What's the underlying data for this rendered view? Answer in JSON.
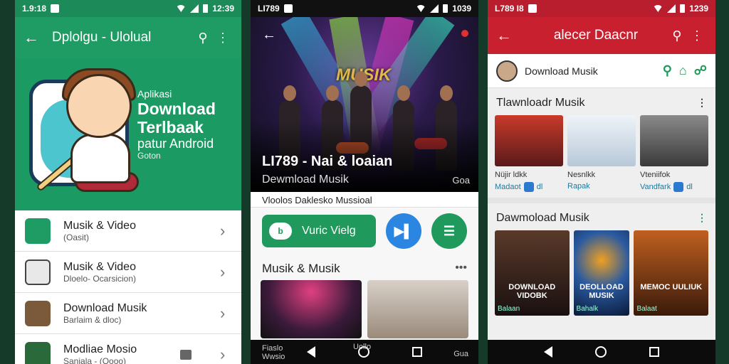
{
  "phone1": {
    "status_time": "1.9:18",
    "status_clock": "12:39",
    "title": "Dplolgu - Ulolual",
    "hero": {
      "line1": "Aplikasi",
      "line2": "Download",
      "line3": "Terlbaak",
      "line4": "patur Android",
      "line5": "Goton"
    },
    "items": [
      {
        "name": "Musik & Video",
        "sub": "(Oasit)",
        "color": "#1e9c64"
      },
      {
        "name": "Musik & Video",
        "sub": "Dloelo- Ocarsicion)",
        "color": "#eeeeee"
      },
      {
        "name": "Download Musik",
        "sub": "Barlaim & dloc)",
        "color": "#7a5a3a"
      },
      {
        "name": "Modliae Mosio",
        "sub": "Saniala - (Oooo)",
        "color": "#2a6a3a"
      }
    ]
  },
  "phone2": {
    "status_time": "LI789",
    "status_clock": "1039",
    "stage_logo": "MUSIK",
    "caption_title": "LI789 - Nai & loaian",
    "caption_sub": "Dewmload Musik",
    "caption_side": "Goa",
    "subline": "Vloolos Daklesko Mussioal",
    "btn_label": "Vuric Vielg",
    "btn_pill": "b",
    "circle1": "▶▌",
    "circle2": "☰",
    "section": "Musik & Musik",
    "nav_left": "Fiaslo Wwsio",
    "nav_mid": "Uollo",
    "nav_right": "Gua"
  },
  "phone3": {
    "status_time": "L789 I8",
    "status_clock": "1239",
    "title": "alecer Daacnr",
    "search_label": "Download Musik",
    "section1": "Tlawnloadr Musik",
    "tiles": [
      {
        "name": "Nüjir ldkk",
        "sub": "Madaot",
        "extra": "dl"
      },
      {
        "name": "Nesnlkk",
        "sub": "Rapak",
        "extra": ""
      },
      {
        "name": "Vteniifok",
        "sub": "Vandfark",
        "extra": "dl"
      }
    ],
    "section2": "Dawmoload Musik",
    "posters": [
      {
        "title": "DOWNLOAD VIDOBK",
        "sub": "Balaan"
      },
      {
        "title": "DEOLLOAD MUSIK",
        "sub": "Bahalk"
      },
      {
        "title": "MEMOC UULIUK",
        "sub": "Balaat"
      }
    ]
  }
}
